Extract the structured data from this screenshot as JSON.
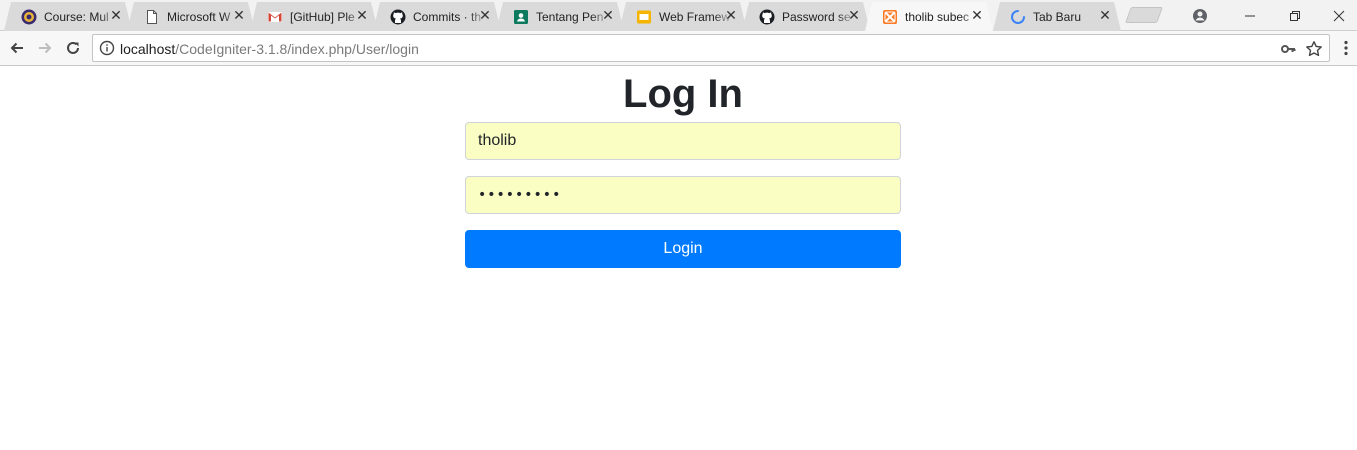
{
  "browser": {
    "tabs": [
      {
        "title": "Course: Mul",
        "icon": "university-logo-icon",
        "active": false
      },
      {
        "title": "Microsoft W",
        "icon": "document-icon",
        "active": false
      },
      {
        "title": "[GitHub] Ple",
        "icon": "gmail-icon",
        "active": false
      },
      {
        "title": "Commits · th",
        "icon": "github-icon",
        "active": false
      },
      {
        "title": "Tentang Pen",
        "icon": "contact-card-icon",
        "active": false
      },
      {
        "title": "Web Framew",
        "icon": "slides-icon",
        "active": false
      },
      {
        "title": "Password se",
        "icon": "github-icon",
        "active": false
      },
      {
        "title": "tholib subec",
        "icon": "xampp-icon",
        "active": true
      },
      {
        "title": "Tab Baru",
        "icon": "loading-spinner-icon",
        "active": false
      }
    ],
    "close_glyph": "✕",
    "url": {
      "host": "localhost",
      "path": "/CodeIgniter-3.1.8/index.php/User/login"
    }
  },
  "login": {
    "heading": "Log In",
    "username_value": "tholib",
    "password_mask": "•••••••••",
    "submit_label": "Login"
  },
  "colors": {
    "primary_button": "#007bff",
    "autofill_background": "#fafec3",
    "heading_text": "#212529"
  }
}
